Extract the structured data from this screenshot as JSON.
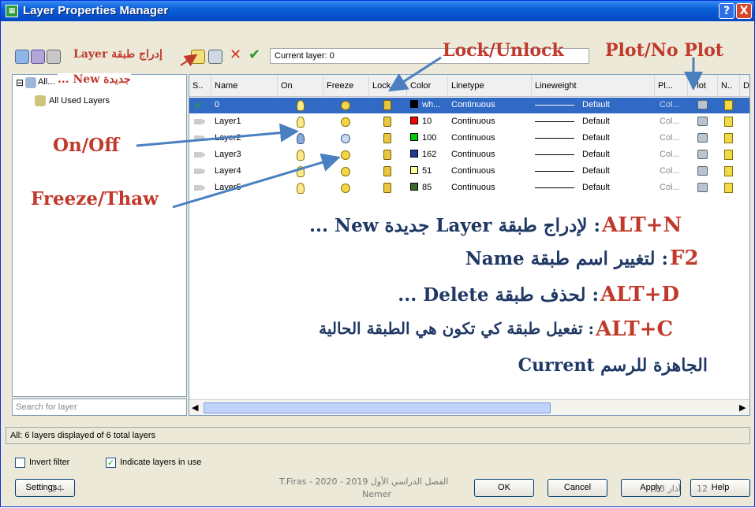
{
  "window": {
    "title": "Layer Properties Manager",
    "help_glyph": "?",
    "close_glyph": "X"
  },
  "toolbar": {
    "current_layer": "Current layer: 0"
  },
  "annotations": {
    "layer_insert_line1": "إدراج طبقة Layer",
    "layer_insert_line2": "جديدة New ...",
    "lock": "Lock/Unlock",
    "plot": "Plot/No Plot",
    "onoff": "On/Off",
    "freeze": "Freeze/Thaw",
    "alt_n_key": "ALT+N",
    "alt_n_text": ": لإدراج طبقة Layer جديدة New ...",
    "f2_key": "F2",
    "f2_text": ": لتغيير اسم طبقة Name",
    "alt_d_key": "ALT+D",
    "alt_d_text": ": لحذف طبقة Delete ...",
    "alt_c_key": "ALT+C",
    "alt_c_text": " : تفعيل طبقة كي تكون هي الطبقة الحالية",
    "current_line": "الجاهزة للرسم Current"
  },
  "tree": {
    "all": "All...",
    "all_used": "All Used Layers",
    "expander": "⊟"
  },
  "search": {
    "placeholder": "Search for layer"
  },
  "columns": [
    "S..",
    "Name",
    "On",
    "Freeze",
    "Lock",
    "Color",
    "Linetype",
    "Lineweight",
    "Pl...",
    "Plot",
    "N..",
    "D"
  ],
  "rows": [
    {
      "name": "0",
      "color_name": "wh...",
      "color_hex": "#000000",
      "linetype": "Continuous",
      "lineweight": "Default",
      "plotstyle": "Col...",
      "on": true,
      "frozen": false
    },
    {
      "name": "Layer1",
      "color_name": "10",
      "color_hex": "#ff0000",
      "linetype": "Continuous",
      "lineweight": "Default",
      "plotstyle": "Col...",
      "on": true,
      "frozen": false
    },
    {
      "name": "Layer2",
      "color_name": "100",
      "color_hex": "#00cc00",
      "linetype": "Continuous",
      "lineweight": "Default",
      "plotstyle": "Col...",
      "on": false,
      "frozen": true
    },
    {
      "name": "Layer3",
      "color_name": "162",
      "color_hex": "#1f3d99",
      "linetype": "Continuous",
      "lineweight": "Default",
      "plotstyle": "Col...",
      "on": true,
      "frozen": false
    },
    {
      "name": "Layer4",
      "color_name": "51",
      "color_hex": "#ffff99",
      "linetype": "Continuous",
      "lineweight": "Default",
      "plotstyle": "Col...",
      "on": true,
      "frozen": false
    },
    {
      "name": "Layer5",
      "color_name": "85",
      "color_hex": "#3a6b2a",
      "linetype": "Continuous",
      "lineweight": "Default",
      "plotstyle": "Col...",
      "on": true,
      "frozen": false
    }
  ],
  "status": {
    "text": "All: 6 layers displayed of 6 total layers"
  },
  "options": {
    "invert_filter": "Invert filter",
    "indicate_layers": "Indicate layers in use",
    "indicate_checked": "✓"
  },
  "buttons": {
    "settings": "Settings...",
    "ok": "OK",
    "cancel": "Cancel",
    "apply": "Apply",
    "help": "Help"
  },
  "footer": {
    "left_num": "24",
    "center_line1": "T.Firas - 2020 - 2019 الفصل الدراسي الأول",
    "center_line2": "Nemer",
    "date": "23 آذار",
    "right_num": "12"
  }
}
